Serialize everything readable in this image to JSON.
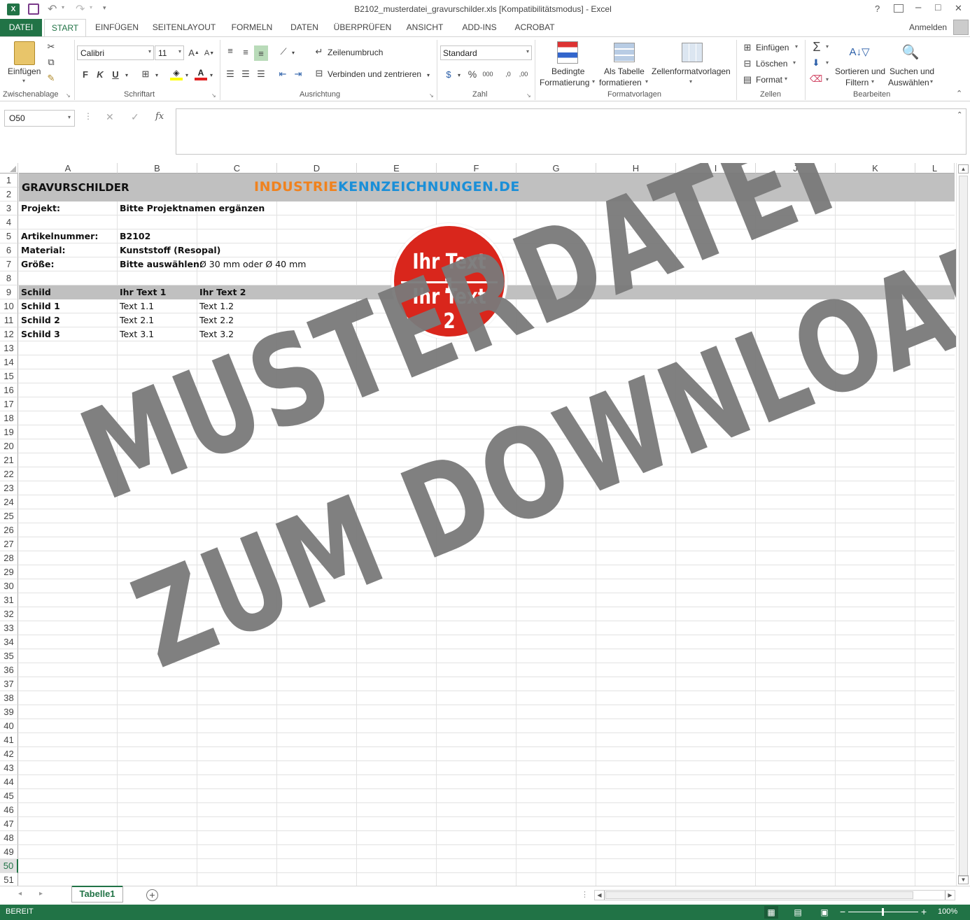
{
  "window": {
    "title": "B2102_musterdatei_gravurschilder.xls  [Kompatibilitätsmodus] - Excel",
    "help": "?",
    "minimize": "–",
    "restore": "□",
    "close": "✕",
    "signin": "Anmelden"
  },
  "tabs": [
    "DATEI",
    "START",
    "EINFÜGEN",
    "SEITENLAYOUT",
    "FORMELN",
    "DATEN",
    "ÜBERPRÜFEN",
    "ANSICHT",
    "ADD-INS",
    "ACROBAT"
  ],
  "ribbon": {
    "clipboard": {
      "paste": "Einfügen",
      "label": "Zwischenablage"
    },
    "font": {
      "name": "Calibri",
      "size": "11",
      "bold": "F",
      "italic": "K",
      "underline": "U",
      "label": "Schriftart"
    },
    "alignment": {
      "wrap": "Zeilenumbruch",
      "merge": "Verbinden und zentrieren",
      "label": "Ausrichtung"
    },
    "number": {
      "format": "Standard",
      "percent": "%",
      "thousands": "000",
      "label": "Zahl"
    },
    "styles": {
      "conditional1": "Bedingte",
      "conditional2": "Formatierung",
      "table1": "Als Tabelle",
      "table2": "formatieren",
      "cellstyles": "Zellenformatvorlagen",
      "label": "Formatvorlagen"
    },
    "cells": {
      "insert": "Einfügen",
      "delete": "Löschen",
      "format": "Format",
      "label": "Zellen"
    },
    "editing": {
      "sort1": "Sortieren und",
      "sort2": "Filtern",
      "find1": "Suchen und",
      "find2": "Auswählen",
      "label": "Bearbeiten"
    }
  },
  "formula_bar": {
    "namebox": "O50",
    "fx": "fx",
    "value": ""
  },
  "columns": [
    "A",
    "B",
    "C",
    "D",
    "E",
    "F",
    "G",
    "H",
    "I",
    "J",
    "K",
    "L"
  ],
  "rows": [
    "1",
    "2",
    "3",
    "4",
    "5",
    "6",
    "7",
    "8",
    "9",
    "10",
    "11",
    "12",
    "13",
    "14",
    "15",
    "16",
    "17",
    "18",
    "19",
    "20",
    "21",
    "22",
    "23",
    "24",
    "25",
    "26",
    "27",
    "28",
    "29",
    "30",
    "31",
    "32",
    "33",
    "34",
    "35",
    "36",
    "37",
    "38",
    "39",
    "40",
    "41",
    "42",
    "43",
    "44",
    "45",
    "46",
    "47",
    "48",
    "49",
    "50",
    "51"
  ],
  "sheet": {
    "title": "GRAVURSCHILDER",
    "logo_part1": "INDUSTRIE",
    "logo_part2": "KENNZEICHNUNGEN.DE",
    "project_label": "Projekt:",
    "project_value": "Bitte Projektnamen ergänzen",
    "article_label": "Artikelnummer:",
    "article_value": "B2102",
    "material_label": "Material:",
    "material_value": "Kunststoff (Resopal)",
    "size_label": "Größe:",
    "size_value1": "Bitte auswählen:",
    "size_value2": "Ø 30 mm oder Ø 40 mm",
    "table_header": [
      "Schild",
      "Ihr Text 1",
      "Ihr Text 2"
    ],
    "table_rows": [
      [
        "Schild 1",
        "Text 1.1",
        "Text 1.2"
      ],
      [
        "Schild 2",
        "Text 2.1",
        "Text 2.2"
      ],
      [
        "Schild 3",
        "Text 3.1",
        "Text 3.2"
      ]
    ],
    "badge_line1": "Ihr Text 1",
    "badge_line2": "Ihr Text 2",
    "watermark_line1": "MUSTERDATEI",
    "watermark_line2": "ZUM DOWNLOAD"
  },
  "sheet_tabs": [
    "Tabelle1"
  ],
  "status": {
    "ready": "BEREIT",
    "zoom": "100%"
  },
  "colors": {
    "excel_green": "#217346",
    "header_band": "#c0c0c0",
    "badge_red": "#d9261c",
    "logo_orange": "#f0821e",
    "logo_blue": "#1a8fd8",
    "watermark": "#7a7a7a"
  }
}
